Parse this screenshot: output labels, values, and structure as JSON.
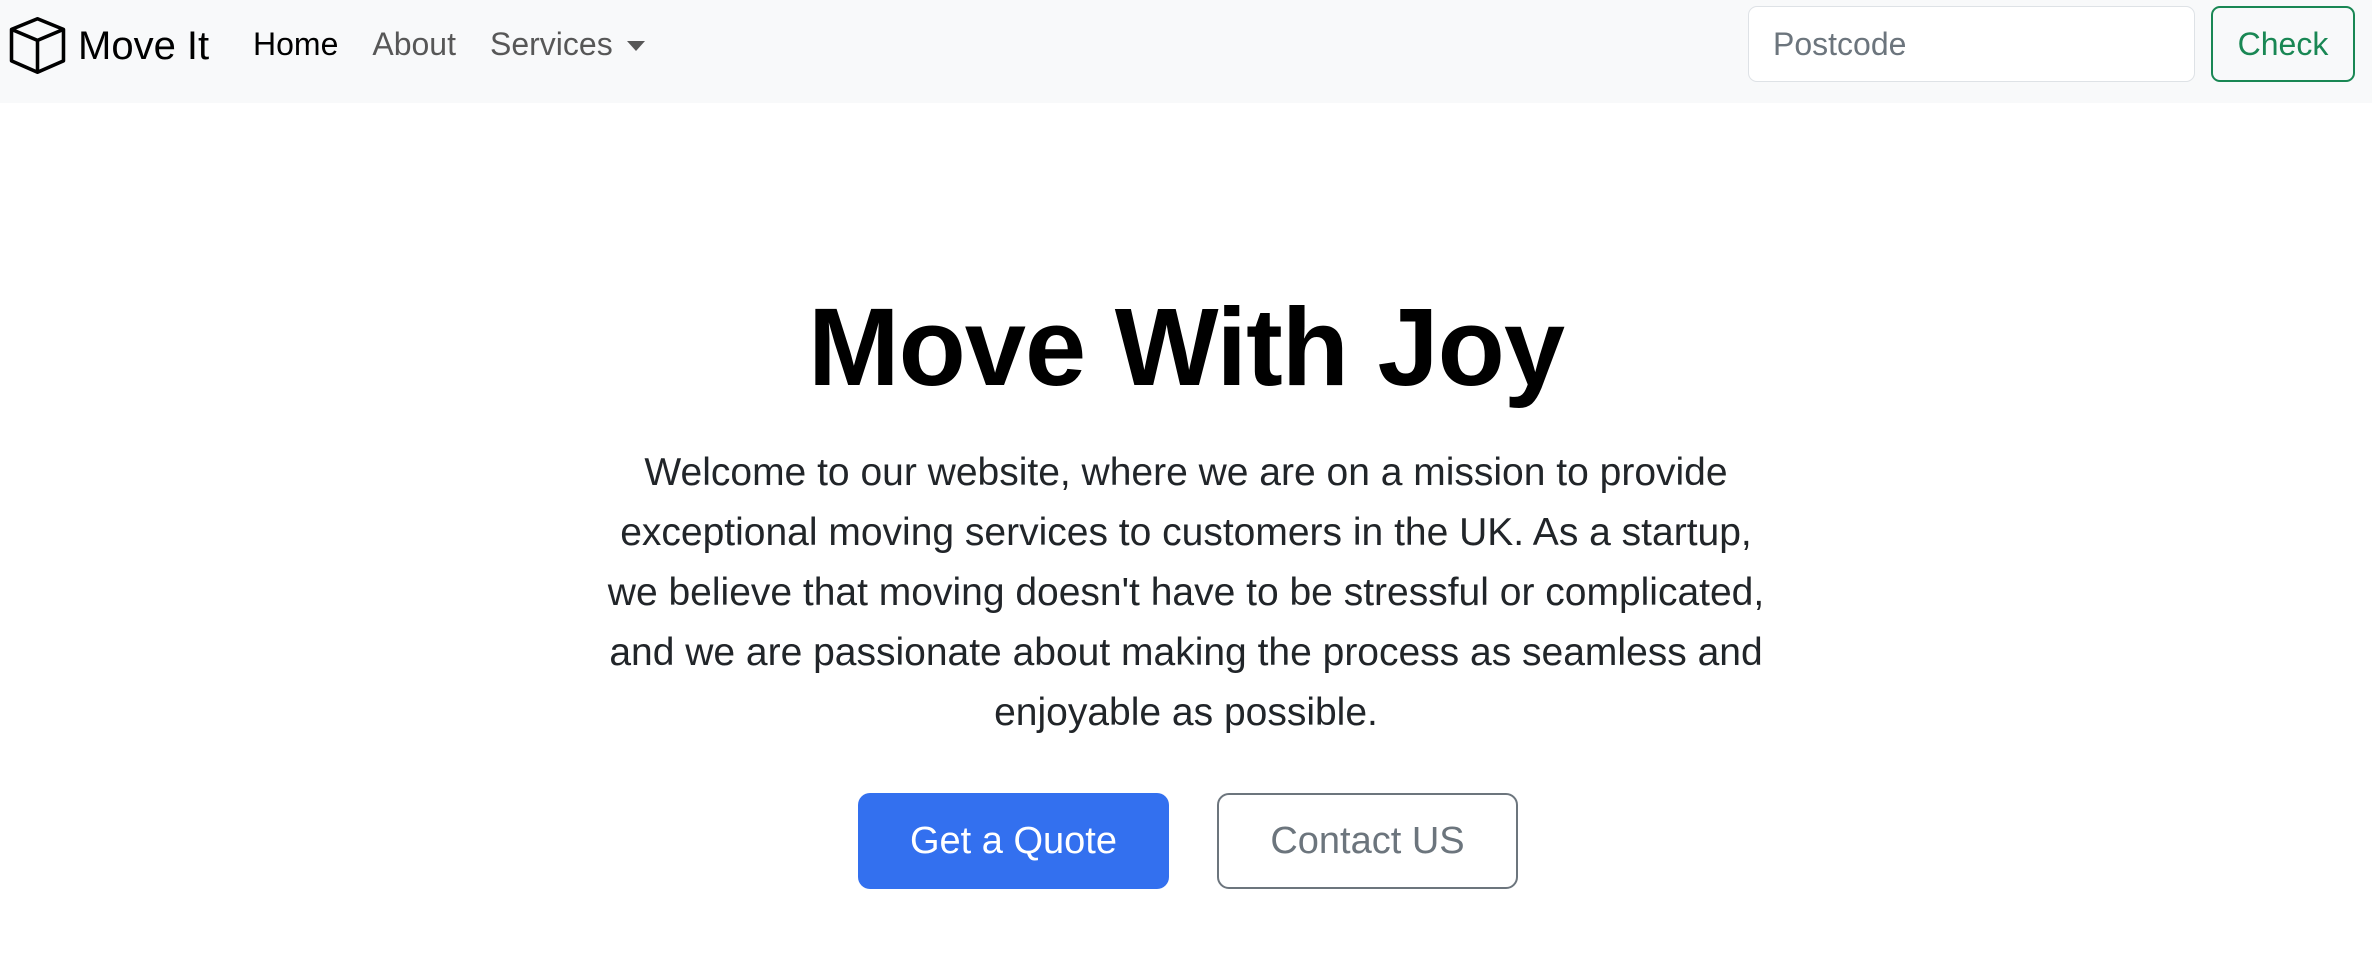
{
  "brand": {
    "name": "Move It",
    "icon": "box-icon"
  },
  "nav": {
    "items": [
      {
        "label": "Home",
        "active": true
      },
      {
        "label": "About",
        "active": false
      },
      {
        "label": "Services",
        "active": false,
        "dropdown": true
      }
    ]
  },
  "search": {
    "placeholder": "Postcode",
    "value": "",
    "button_label": "Check"
  },
  "hero": {
    "title": "Move With Joy",
    "lead": "Welcome to our website, where we are on a mission to provide exceptional moving services to customers in the UK. As a startup, we believe that moving doesn't have to be stressful or complicated, and we are passionate about making the process as seamless and enjoyable as possible.",
    "primary_button": "Get a Quote",
    "secondary_button": "Contact US"
  },
  "colors": {
    "navbar_bg": "#f8f9fa",
    "primary": "#3370ef",
    "success": "#198754",
    "secondary": "#6c757d"
  }
}
